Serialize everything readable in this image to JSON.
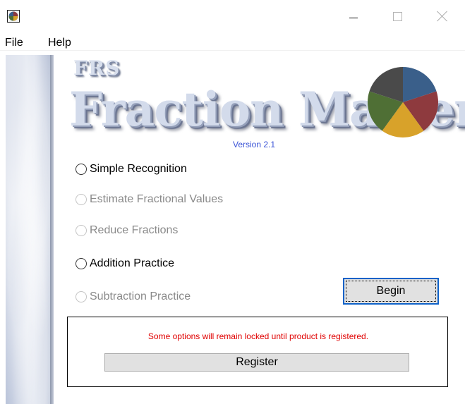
{
  "window": {
    "controls": {
      "minimize": "–",
      "maximize": "□",
      "close": "✕"
    }
  },
  "menu": {
    "file": "File",
    "help": "Help"
  },
  "logo": {
    "brand": "FRS",
    "title": "Fraction Master",
    "version": "Version 2.1"
  },
  "pie_colors": [
    "#3a5f8a",
    "#8e3a3e",
    "#d8a22a",
    "#4f6f35",
    "#4a4a4a"
  ],
  "options": [
    {
      "label": "Simple Recognition",
      "enabled": true
    },
    {
      "label": "Estimate Fractional Values",
      "enabled": false
    },
    {
      "label": "Reduce Fractions",
      "enabled": false
    },
    {
      "label": "Addition Practice",
      "enabled": true
    },
    {
      "label": "Subtraction Practice",
      "enabled": false
    }
  ],
  "buttons": {
    "begin": "Begin",
    "register": "Register"
  },
  "register_panel": {
    "message": "Some options will remain locked until product is registered."
  },
  "colors": {
    "accent": "#0f62c8",
    "warning": "#e00000",
    "version": "#3a53d6",
    "disabled": "#8a8a8a"
  }
}
